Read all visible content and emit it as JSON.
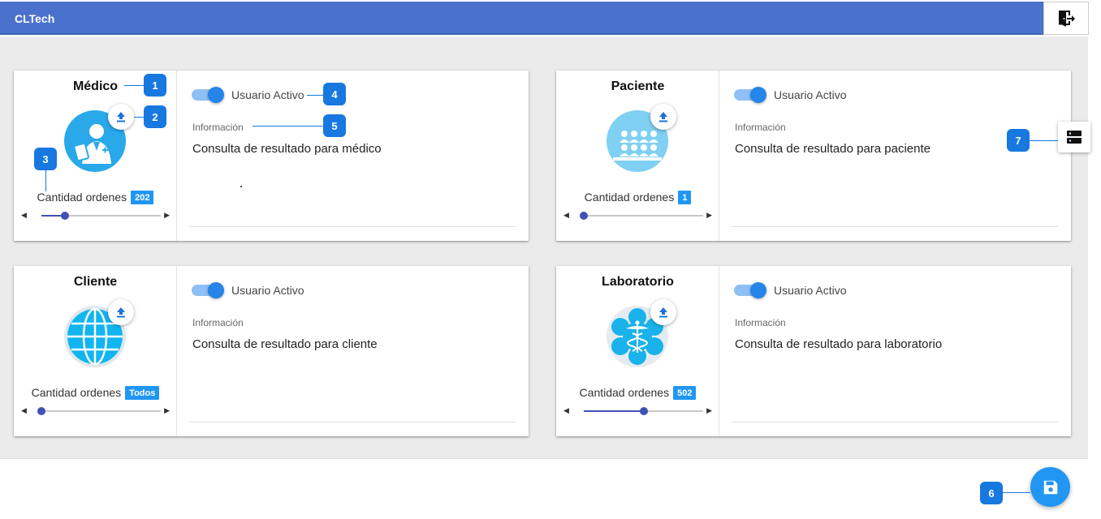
{
  "header": {
    "title": "CLTech",
    "logout_icon": "logout-door-icon"
  },
  "cards": [
    {
      "title": "Médico",
      "toggle_label": "Usuario Activo",
      "active": true,
      "info_label": "Información",
      "info_text": "Consulta de resultado para médico",
      "qty_label": "Cantidad ordenes",
      "qty_badge": "202",
      "slider_fraction": 0.2,
      "avatar_icon": "doctor-icon",
      "upload_icon": "upload-icon"
    },
    {
      "title": "Paciente",
      "toggle_label": "Usuario Activo",
      "active": true,
      "info_label": "Información",
      "info_text": "Consulta de resultado para paciente",
      "qty_label": "Cantidad ordenes",
      "qty_badge": "1",
      "slider_fraction": 0.0,
      "avatar_icon": "patients-audience-icon",
      "upload_icon": "upload-icon"
    },
    {
      "title": "Cliente",
      "toggle_label": "Usuario Activo",
      "active": true,
      "info_label": "Información",
      "info_text": "Consulta de resultado para cliente",
      "qty_label": "Cantidad ordenes",
      "qty_badge": "Todos",
      "slider_fraction": 0.0,
      "avatar_icon": "globe-icon",
      "upload_icon": "upload-icon"
    },
    {
      "title": "Laboratorio",
      "toggle_label": "Usuario Activo",
      "active": true,
      "info_label": "Información",
      "info_text": "Consulta de resultado para laboratorio",
      "qty_label": "Cantidad ordenes",
      "qty_badge": "502",
      "slider_fraction": 0.5,
      "avatar_icon": "medical-caduceus-icon",
      "upload_icon": "upload-icon"
    }
  ],
  "fab": {
    "icon": "save-icon"
  },
  "side_button": {
    "icon": "server-list-icon"
  },
  "callouts": [
    "1",
    "2",
    "3",
    "4",
    "5",
    "6",
    "7"
  ],
  "colors": {
    "topbar": "#4a72cc",
    "accent": "#2196f3",
    "slider": "#3f51b5",
    "callout": "#1778e0",
    "background": "#ebebeb"
  }
}
